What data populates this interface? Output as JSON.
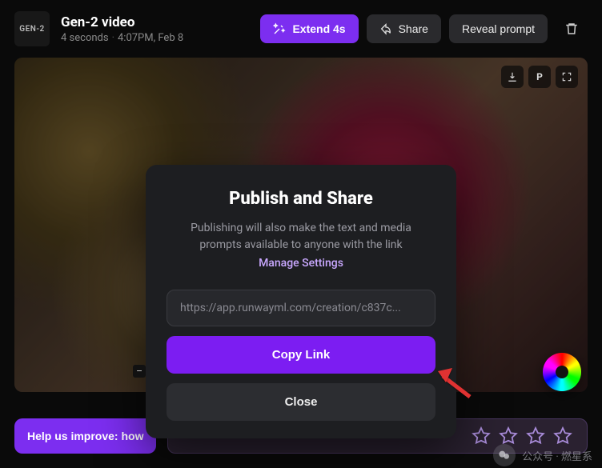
{
  "header": {
    "logo_text": "GEN-2",
    "title": "Gen-2 video",
    "duration": "4 seconds",
    "timestamp": "4:07PM, Feb 8",
    "extend_label": "Extend 4s",
    "share_label": "Share",
    "reveal_label": "Reveal prompt"
  },
  "modal": {
    "title": "Publish and Share",
    "desc_line1": "Publishing will also make the text and media",
    "desc_line2": "prompts available to anyone with the link",
    "manage_label": "Manage Settings",
    "url_value": "https://app.runwayml.com/creation/c837c...",
    "copy_label": "Copy Link",
    "close_label": "Close",
    "page_indicator": "–"
  },
  "bottom": {
    "feedback_label": "Help us improve: how"
  },
  "watermark": {
    "text": "公众号 · 燃星系"
  }
}
